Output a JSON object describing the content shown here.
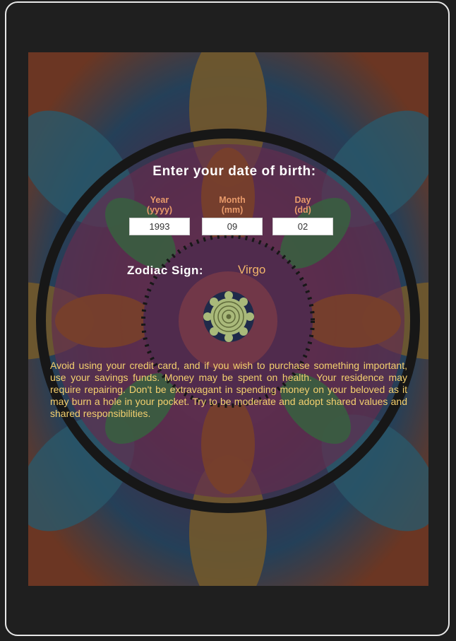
{
  "form": {
    "heading": "Enter your date of birth:",
    "year": {
      "label_line1": "Year",
      "label_line2": "(yyyy)",
      "value": "1993"
    },
    "month": {
      "label_line1": "Month",
      "label_line2": "(mm)",
      "value": "09"
    },
    "day": {
      "label_line1": "Day",
      "label_line2": "(dd)",
      "value": "02"
    }
  },
  "result": {
    "zodiac_label": "Zodiac Sign:",
    "zodiac_value": "Virgo",
    "icon": "virgo-mandala-icon",
    "horoscope": "Avoid using your credit card, and if you wish to purchase something important, use your savings funds. Money may be spent on health. Your residence may require repairing. Don't be extravagant in spending money on your beloved as it may burn a hole in your pocket. Try to be moderate and adopt shared values and shared responsibilities."
  },
  "colors": {
    "bezel": "#1f1f1f",
    "label_accent": "#e89a6a",
    "zodiac_accent": "#f2b56a",
    "horoscope_text": "#f4d06e",
    "badge": "#a9b97a"
  }
}
